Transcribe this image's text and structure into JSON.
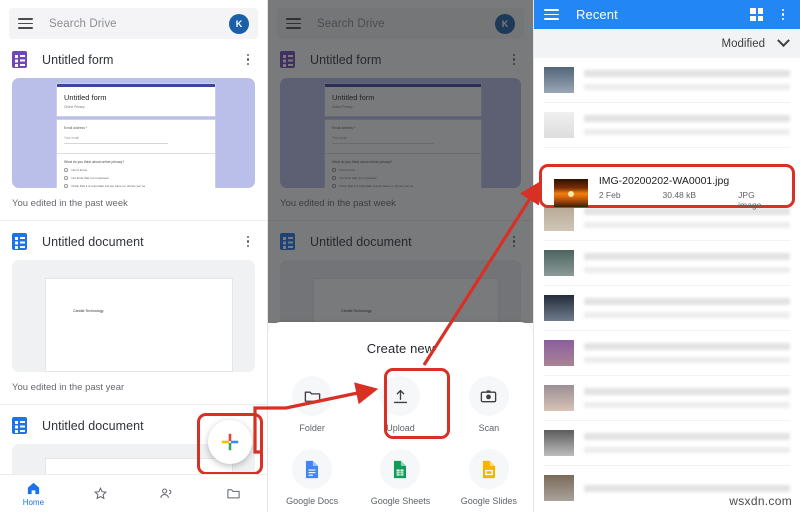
{
  "search": {
    "placeholder": "Search Drive",
    "avatar_initial": "K"
  },
  "left_panel": {
    "items": [
      {
        "title": "Untitled form",
        "icon": "forms-icon",
        "edited": "You edited in the past week"
      },
      {
        "title": "Untitled document",
        "icon": "docs-icon",
        "edited": "You edited in the past year"
      },
      {
        "title": "Untitled document",
        "icon": "docs-icon",
        "edited": ""
      }
    ],
    "form_preview": {
      "title": "Untitled form",
      "subtitle": "Online Privacy",
      "email_label": "Email address *",
      "email_placeholder": "Your email",
      "question": "What do you think about online privacy?",
      "options": [
        "I don't know",
        "I do think that it is important",
        "I think that it is important but we have no choice per se"
      ]
    },
    "doc_preview": {
      "body": "Candid Technology"
    },
    "bottom_nav": [
      {
        "label": "Home",
        "icon": "home-icon"
      },
      {
        "label": "",
        "icon": "star-icon"
      },
      {
        "label": "",
        "icon": "shared-people-icon"
      },
      {
        "label": "",
        "icon": "folder-icon"
      }
    ],
    "fab": {
      "icon": "plus-icon",
      "label": ""
    }
  },
  "middle_panel": {
    "sheet_title": "Create new",
    "actions": [
      {
        "label": "Folder",
        "icon": "folder-icon"
      },
      {
        "label": "Upload",
        "icon": "upload-icon"
      },
      {
        "label": "Scan",
        "icon": "scan-camera-icon"
      },
      {
        "label": "Google Docs",
        "icon": "google-docs-icon"
      },
      {
        "label": "Google Sheets",
        "icon": "google-sheets-icon"
      },
      {
        "label": "Google Slides",
        "icon": "google-slides-icon"
      }
    ]
  },
  "right_panel": {
    "appbar": {
      "title": "Recent",
      "menu_icon": "hamburger-icon",
      "grid_icon": "grid-view-icon",
      "overflow_icon": "more-vert-icon"
    },
    "sort": {
      "label": "Modified",
      "icon": "chevron-down-icon"
    },
    "highlighted_file": {
      "name": "IMG-20200202-WA0001.jpg",
      "date": "2 Feb",
      "size": "30.48 kB",
      "type": "JPG image"
    },
    "redacted_rows": 12
  },
  "watermark": "wsxdn.com",
  "colors": {
    "accent_blue": "#2286f5",
    "highlight_red": "#d93025",
    "forms_purple": "#7248b9",
    "docs_blue": "#1b74e8",
    "avatar_blue": "#1a5fa8"
  }
}
